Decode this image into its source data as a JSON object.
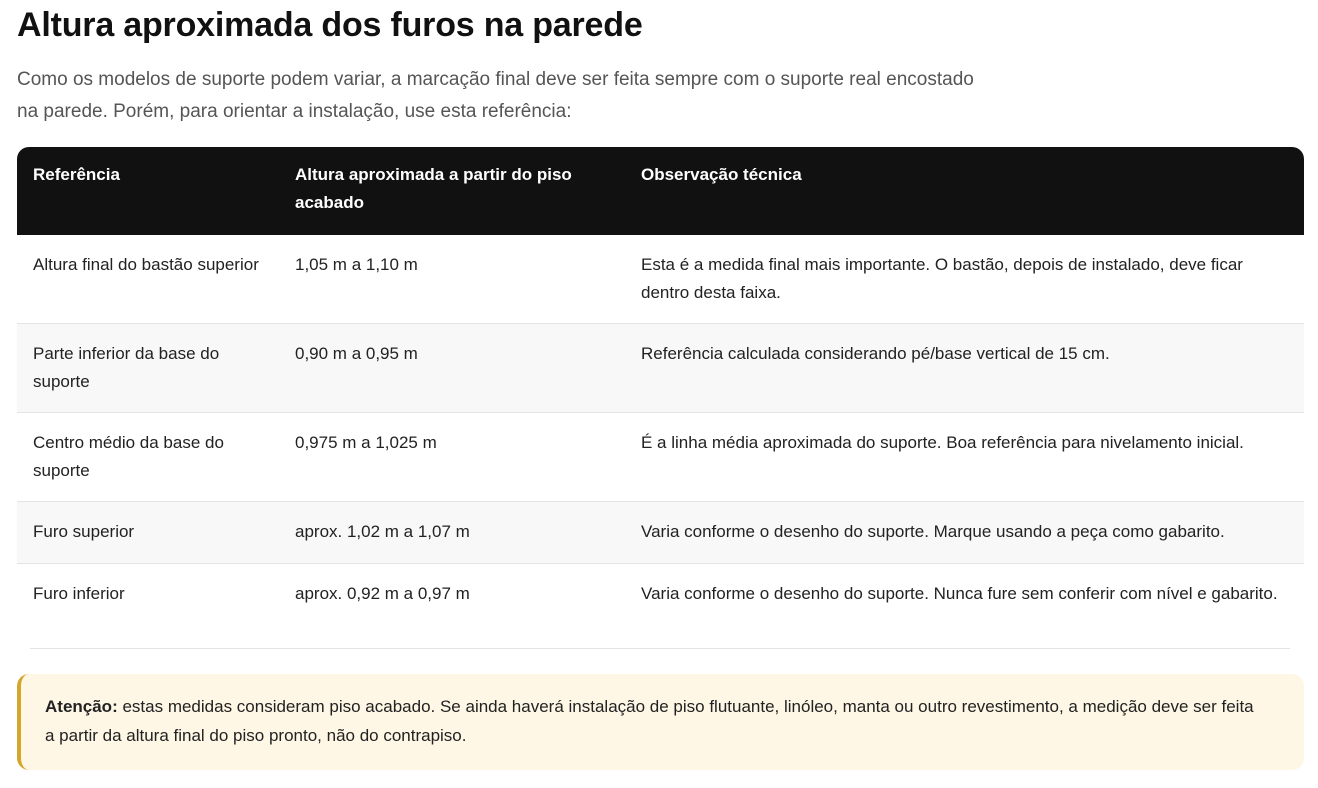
{
  "title": "Altura aproximada dos furos na parede",
  "intro": "Como os modelos de suporte podem variar, a marcação final deve ser feita sempre com o suporte real encostado na parede. Porém, para orientar a instalação, use esta referência:",
  "table": {
    "headers": [
      "Referência",
      "Altura aproximada a partir do piso acabado",
      "Observação técnica"
    ],
    "rows": [
      [
        "Altura final do bastão superior",
        "1,05 m a 1,10 m",
        "Esta é a medida final mais importante. O bastão, depois de instalado, deve ficar dentro desta faixa."
      ],
      [
        "Parte inferior da base do suporte",
        "0,90 m a 0,95 m",
        "Referência calculada considerando pé/base vertical de 15 cm."
      ],
      [
        "Centro médio da base do suporte",
        "0,975 m a 1,025 m",
        "É a linha média aproximada do suporte. Boa referência para nivelamento inicial."
      ],
      [
        "Furo superior",
        "aprox. 1,02 m a 1,07 m",
        "Varia conforme o desenho do suporte. Marque usando a peça como gabarito."
      ],
      [
        "Furo inferior",
        "aprox. 0,92 m a 0,97 m",
        "Varia conforme o desenho do suporte. Nunca fure sem conferir com nível e gabarito."
      ]
    ]
  },
  "note": {
    "label": "Atenção:",
    "text": " estas medidas consideram piso acabado. Se ainda haverá instalação de piso flutuante, linóleo, manta ou outro revestimento, a medição deve ser feita a partir da altura final do piso pronto, não do contrapiso."
  },
  "colors": {
    "header_bg": "#111111",
    "note_bg": "#fff7e6",
    "note_border": "#d4a72c"
  }
}
